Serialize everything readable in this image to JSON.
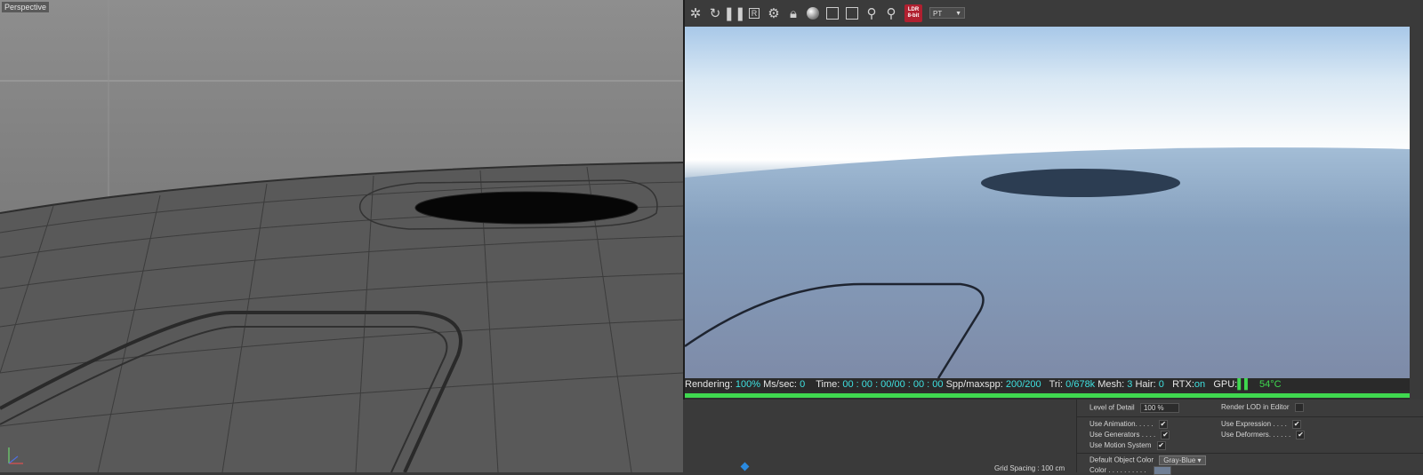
{
  "viewport": {
    "label": "Perspective",
    "grid_spacing": "Grid Spacing : 100 cm"
  },
  "toolbar": {
    "icons": [
      "gear-spin-icon",
      "refresh-icon",
      "pause-icon",
      "region-icon",
      "settings-icon",
      "lock-icon",
      "material-sphere-icon",
      "frame-icon",
      "frame-alt-icon",
      "pin-icon",
      "pin-alt-icon"
    ],
    "ldr_label": "LDR",
    "ldr_sub": "8-bit",
    "kernel_select": "PT"
  },
  "status": {
    "rendering_label": "Rendering:",
    "rendering_val": "100%",
    "ms_label": "Ms/sec:",
    "ms_val": "0",
    "time_label": "Time:",
    "time_val": "00 : 00 : 00/00 : 00 : 00",
    "spp_label": "Spp/maxspp:",
    "spp_val": "200/200",
    "tri_label": "Tri:",
    "tri_val": "0/678k",
    "mesh_label": "Mesh:",
    "mesh_val": "3",
    "hair_label": "Hair:",
    "hair_val": "0",
    "rtx_label": "RTX:",
    "rtx_val": "on",
    "gpu_label": "GPU:",
    "temp_val": "54°C",
    "progress": 1.0,
    "accent": "#3fd84f"
  },
  "attributes": {
    "lod_label": "Level of Detail",
    "lod_val": "100 %",
    "render_lod_label": "Render LOD in Editor",
    "use_animation": "Use Animation. . . . .",
    "use_expression": "Use Expression . . . .",
    "use_generators": "Use Generators . . . .",
    "use_deformers": "Use Deformers. . . . . .",
    "use_motion": "Use Motion System",
    "default_color_label": "Default Object Color",
    "default_color_val": "Gray-Blue",
    "color_label": "Color . . . . . . . . . ."
  }
}
